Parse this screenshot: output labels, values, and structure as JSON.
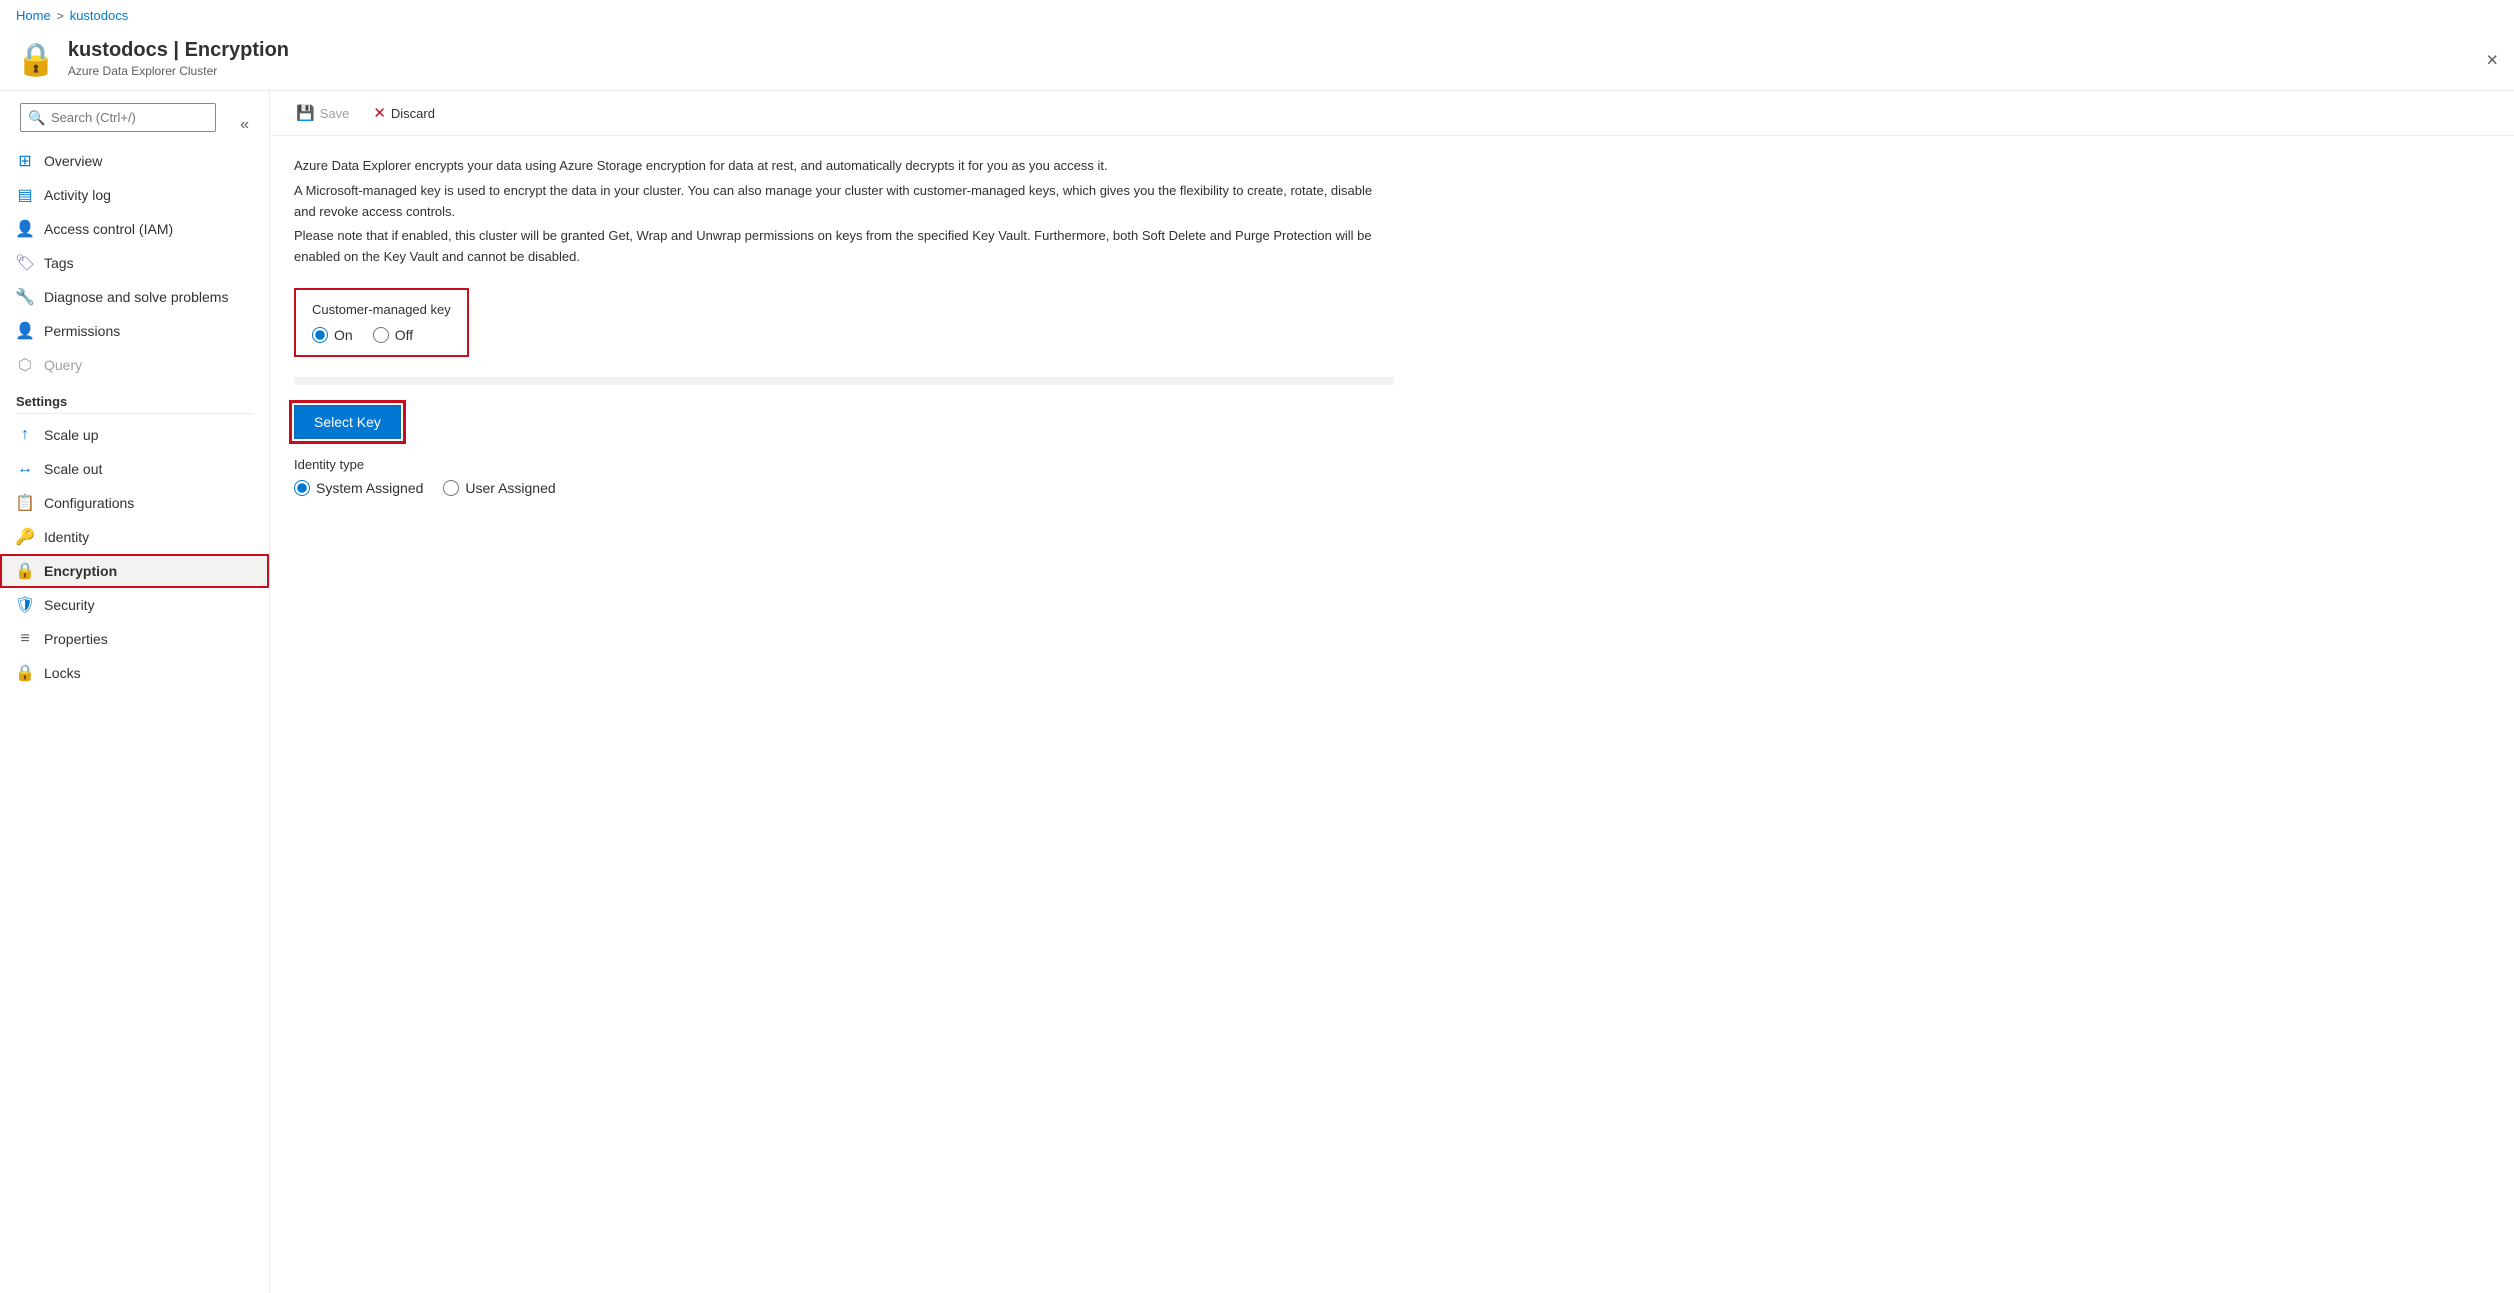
{
  "breadcrumb": {
    "home": "Home",
    "separator": ">",
    "current": "kustodocs"
  },
  "header": {
    "title": "kustodocs | Encryption",
    "subtitle": "Azure Data Explorer Cluster",
    "close_label": "×"
  },
  "search": {
    "placeholder": "Search (Ctrl+/)"
  },
  "sidebar": {
    "collapse_label": "«",
    "nav_items": [
      {
        "id": "overview",
        "label": "Overview",
        "icon": "⊞",
        "color": "#0078d4",
        "disabled": false,
        "active": false
      },
      {
        "id": "activity-log",
        "label": "Activity log",
        "icon": "≡",
        "color": "#0078d4",
        "disabled": false,
        "active": false
      },
      {
        "id": "access-control",
        "label": "Access control (IAM)",
        "icon": "☺",
        "color": "#0078d4",
        "disabled": false,
        "active": false
      },
      {
        "id": "tags",
        "label": "Tags",
        "icon": "🏷",
        "color": "#8764b8",
        "disabled": false,
        "active": false
      },
      {
        "id": "diagnose",
        "label": "Diagnose and solve problems",
        "icon": "🔧",
        "color": "#605e5c",
        "disabled": false,
        "active": false
      },
      {
        "id": "permissions",
        "label": "Permissions",
        "icon": "👤",
        "color": "#0078d4",
        "disabled": false,
        "active": false
      },
      {
        "id": "query",
        "label": "Query",
        "icon": "⊞",
        "color": "#a19f9d",
        "disabled": true,
        "active": false
      }
    ],
    "settings_label": "Settings",
    "settings_items": [
      {
        "id": "scale-up",
        "label": "Scale up",
        "icon": "⬆",
        "color": "#0078d4",
        "disabled": false,
        "active": false
      },
      {
        "id": "scale-out",
        "label": "Scale out",
        "icon": "↔",
        "color": "#0078d4",
        "disabled": false,
        "active": false
      },
      {
        "id": "configurations",
        "label": "Configurations",
        "icon": "📋",
        "color": "#c50f1f",
        "disabled": false,
        "active": false
      },
      {
        "id": "identity",
        "label": "Identity",
        "icon": "🔑",
        "color": "#f7b731",
        "disabled": false,
        "active": false
      },
      {
        "id": "encryption",
        "label": "Encryption",
        "icon": "🔒",
        "color": "#605e5c",
        "disabled": false,
        "active": true
      },
      {
        "id": "security",
        "label": "Security",
        "icon": "🛡",
        "color": "#0078d4",
        "disabled": false,
        "active": false
      },
      {
        "id": "properties",
        "label": "Properties",
        "icon": "≡",
        "color": "#605e5c",
        "disabled": false,
        "active": false
      },
      {
        "id": "locks",
        "label": "Locks",
        "icon": "🔒",
        "color": "#605e5c",
        "disabled": false,
        "active": false
      }
    ]
  },
  "toolbar": {
    "save_label": "Save",
    "discard_label": "Discard"
  },
  "content": {
    "description_lines": [
      "Azure Data Explorer encrypts your data using Azure Storage encryption for data at rest, and automatically decrypts it for you as you access it.",
      "A Microsoft-managed key is used to encrypt the data in your cluster. You can also manage your cluster with customer-managed keys, which gives you the flexibility to create, rotate, disable and revoke access controls.",
      "Please note that if enabled, this cluster will be granted Get, Wrap and Unwrap permissions on keys from the specified Key Vault. Furthermore, both Soft Delete and Purge Protection will be enabled on the Key Vault and cannot be disabled."
    ],
    "customer_managed_key_label": "Customer-managed key",
    "radio_on_label": "On",
    "radio_off_label": "Off",
    "select_key_label": "Select Key",
    "identity_type_label": "Identity type",
    "identity_system_assigned": "System Assigned",
    "identity_user_assigned": "User Assigned"
  }
}
